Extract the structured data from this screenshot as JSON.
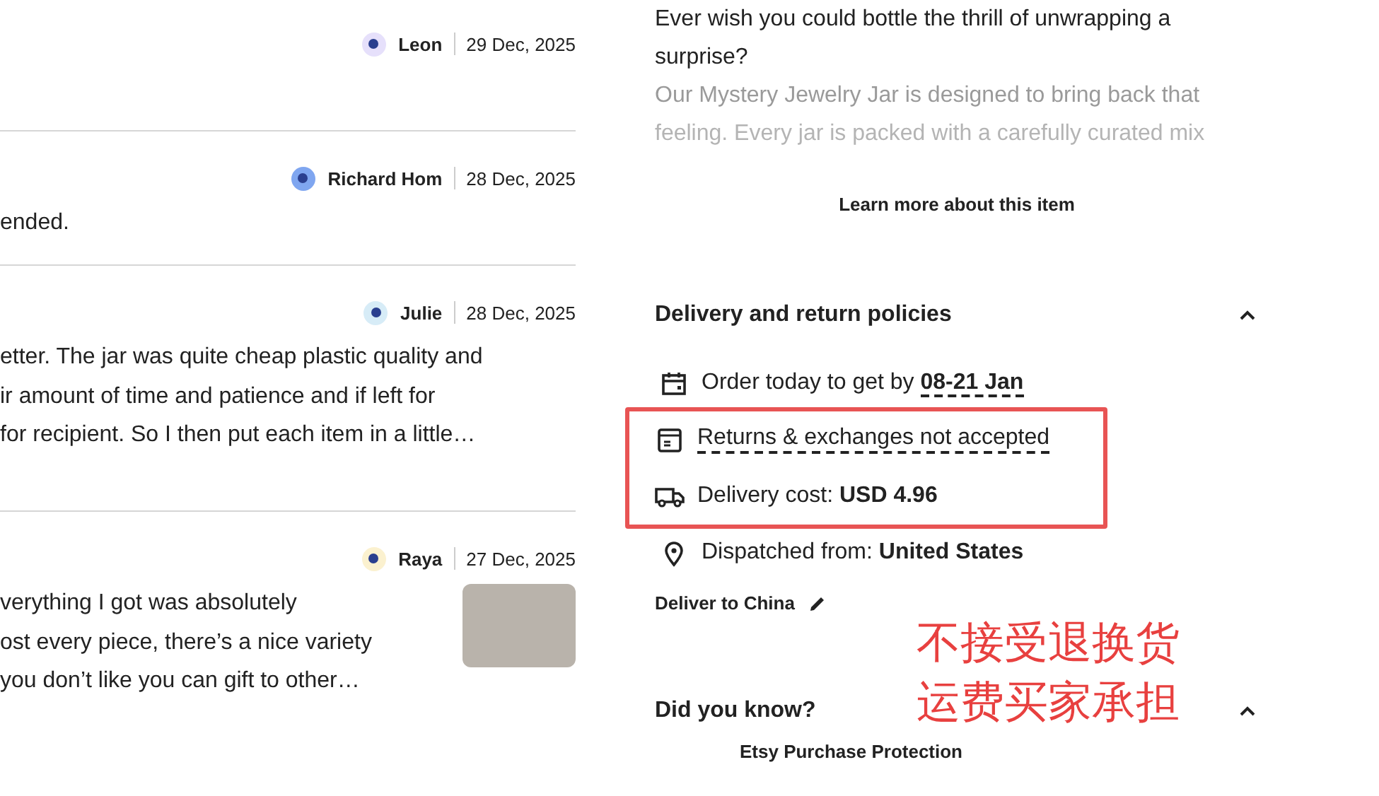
{
  "reviews": [
    {
      "author": "Leon",
      "date": "29 Dec, 2025",
      "color": "#e6e0fb",
      "has_photo": false
    },
    {
      "author": "Richard Hom",
      "date": "28 Dec, 2025",
      "color": "#7fa6f0",
      "lines": [
        "ended."
      ],
      "has_photo": false
    },
    {
      "author": "Julie",
      "date": "28 Dec, 2025",
      "color": "#d7ecf7",
      "lines": [
        "etter. The jar was quite cheap plastic quality and",
        "ir amount of time and patience and if left for",
        "for recipient. So I then put each item in a little…"
      ],
      "has_photo": false
    },
    {
      "author": "Raya",
      "date": "27 Dec, 2025",
      "color": "#fbf1cf",
      "lines": [
        "verything I got was absolutely",
        "ost every piece, there’s a nice variety",
        "you don’t like you can gift to other…"
      ],
      "has_photo": true
    }
  ],
  "description": {
    "lines": [
      "Ever wish you could bottle the thrill of unwrapping a",
      "surprise?",
      "Our Mystery Jewelry Jar is designed to bring back that",
      "feeling. Every jar is packed with a carefully curated mix"
    ],
    "learn_more": "Learn more about this item"
  },
  "delivery": {
    "title": "Delivery and return policies",
    "expanded": true,
    "items": [
      {
        "kind": "calendar",
        "text": "Order today to get by ",
        "value": "08-21 Jan",
        "highlighted": false
      },
      {
        "kind": "returns",
        "text": "Returns & exchanges not accepted",
        "highlighted": true
      },
      {
        "kind": "truck",
        "text": "Delivery cost: ",
        "value": "USD 4.96",
        "highlighted": true
      },
      {
        "kind": "pin",
        "text": "Dispatched from: ",
        "value": "United States",
        "highlighted": false
      }
    ],
    "deliver_to": "Deliver to China"
  },
  "annotation": {
    "lines": [
      "不接受退换货",
      "运费买家承担"
    ]
  },
  "did_you_know": {
    "title": "Did you know?",
    "expanded": true,
    "first_item": "Etsy Purchase Protection"
  }
}
